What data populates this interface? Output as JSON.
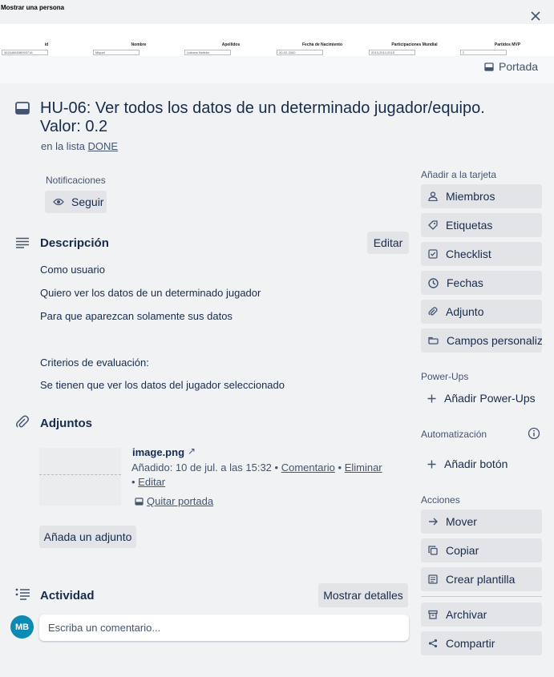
{
  "cover": {
    "title": "Mostrar una persona",
    "columns": [
      "id",
      "Nombre",
      "Apellidos",
      "Fecha de Nacimiento",
      "Participaciones Mundial",
      "Partidos MVP"
    ],
    "row": [
      "3620486536093716",
      "Miguel",
      "Lizbano Beltrán",
      "20-02-2000",
      "2013,2014,2015",
      "2"
    ],
    "button_label": "Portada"
  },
  "card": {
    "title": "HU-06: Ver todos los datos de un determinado jugador/equipo. Valor: 0.2",
    "list_prefix": "en la lista",
    "list_name": "DONE"
  },
  "notifications": {
    "label": "Notificaciones",
    "follow_label": "Seguir"
  },
  "description": {
    "heading": "Descripción",
    "edit_label": "Editar",
    "lines": [
      "Como usuario",
      "Quiero ver los datos de un determinado jugador",
      "Para que aparezcan solamente sus datos",
      "Criterios de evaluación:",
      "Se tienen que ver los datos del jugador seleccionado"
    ]
  },
  "attachments": {
    "heading": "Adjuntos",
    "item": {
      "name": "image.png",
      "added": "Añadido: 10 de jul. a las 15:32",
      "comment": "Comentario",
      "delete": "Eliminar",
      "edit": "Editar",
      "remove_cover": "Quitar portada"
    },
    "add_label": "Añada un adjunto"
  },
  "activity": {
    "heading": "Actividad",
    "details_label": "Mostrar detalles",
    "avatar_initials": "MB",
    "comment_placeholder": "Escriba un comentario..."
  },
  "sidebar": {
    "add_to_card": "Añadir a la tarjeta",
    "add_items": [
      "Miembros",
      "Etiquetas",
      "Checklist",
      "Fechas",
      "Adjunto",
      "Campos personaliza..."
    ],
    "powerups_label": "Power-Ups",
    "add_powerups": "Añadir Power-Ups",
    "automation_label": "Automatización",
    "add_button": "Añadir botón",
    "actions_label": "Acciones",
    "actions": [
      "Mover",
      "Copiar",
      "Crear plantilla",
      "Archivar",
      "Compartir"
    ]
  },
  "colors": {
    "background": "#f1f2f4",
    "button": "#e2e4e8",
    "text": "#172b4d",
    "subtle": "#44546f",
    "avatar": "#0a8bb3"
  }
}
